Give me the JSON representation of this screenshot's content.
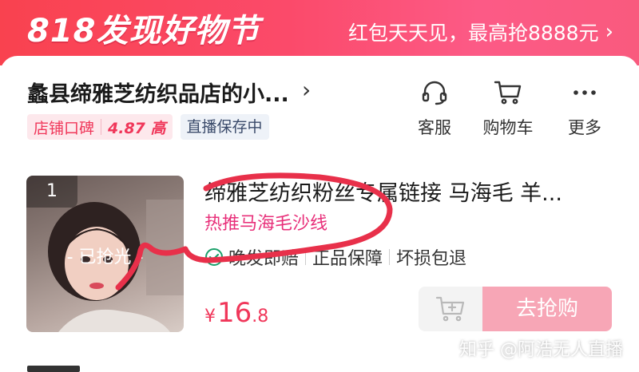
{
  "banner": {
    "title": "818发现好物节",
    "promo": "红包天天见，最高抢8888元",
    "chevron": "›"
  },
  "store": {
    "name": "蠡县缔雅芝纺织品店的小...",
    "chevron": "›",
    "reputation_label": "店铺口碑",
    "reputation_value": "4.87 高",
    "live_badge": "直播保存中"
  },
  "tools": [
    {
      "label": "客服",
      "icon": "headset-icon"
    },
    {
      "label": "购物车",
      "icon": "cart-icon"
    },
    {
      "label": "更多",
      "icon": "more-icon"
    }
  ],
  "product": {
    "rank": "1",
    "sold_overlay": "- 已抢光 -",
    "title": "缔雅芝纺织粉丝专属链接 马海毛 羊...",
    "hot_tag": "热推马海毛沙线",
    "guarantees": [
      "晚发即赔",
      "正品保障",
      "坏损包退"
    ],
    "price_currency": "¥",
    "price_int": "16",
    "price_dec": ".8",
    "buy_label": "去抢购"
  },
  "watermark": "知乎 @阿浩无人直播",
  "colors": {
    "brand": "#f0375a",
    "banner": "#fb4a6a",
    "buy_button": "#f7a6b6",
    "hot_tag": "#e8307a",
    "annotation": "#e8304a"
  }
}
